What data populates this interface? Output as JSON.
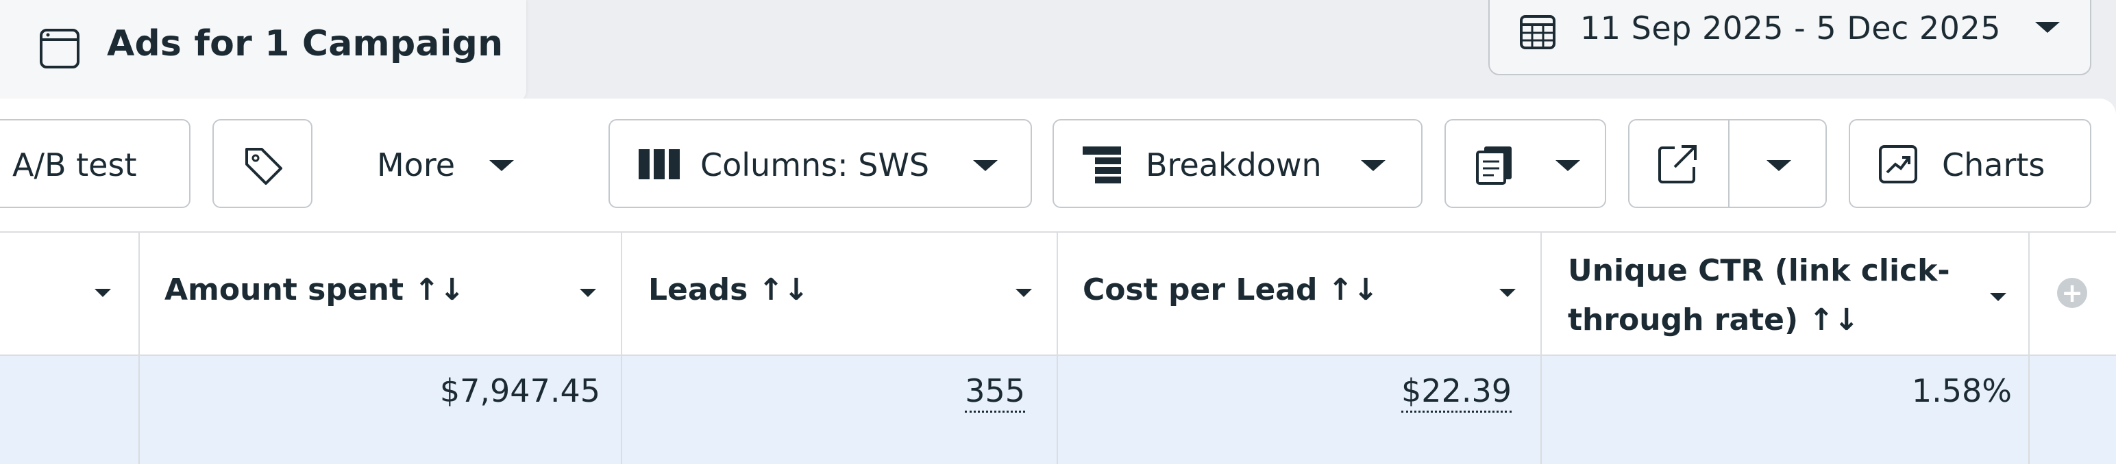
{
  "tab": {
    "title": "Ads for 1 Campaign",
    "icon": "window-icon"
  },
  "date_range": {
    "label": "11 Sep 2025 - 5 Dec 2025",
    "icon": "calendar-icon"
  },
  "toolbar": {
    "ab_test": "A/B test",
    "tag_icon": "tag-icon",
    "more": "More",
    "columns": "Columns: SWS",
    "breakdown": "Breakdown",
    "reports_icon": "reports-icon",
    "export_icon": "export-icon",
    "charts": "Charts"
  },
  "table": {
    "headers": {
      "amount_spent": "Amount spent ↑↓",
      "leads": "Leads ↑↓",
      "cost_per_lead": "Cost per Lead ↑↓",
      "unique_ctr_line1": "Unique CTR (link click-",
      "unique_ctr_line2": "through rate) ↑↓"
    },
    "row": {
      "amount_spent": "$7,947.45",
      "leads": "355",
      "cost_per_lead": "$22.39",
      "unique_ctr": "1.58%"
    }
  },
  "colors": {
    "row_highlight": "#e7f0fb",
    "border": "#c4c9ce",
    "text": "#1c2b33"
  }
}
